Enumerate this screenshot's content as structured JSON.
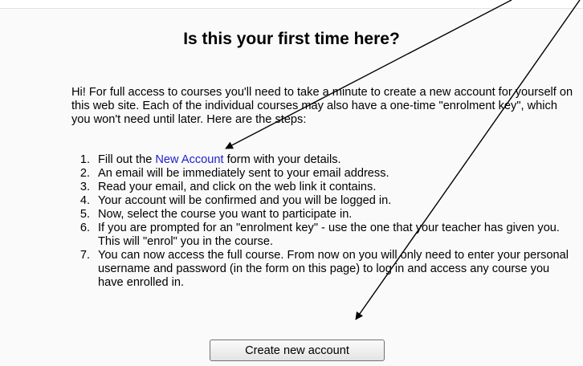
{
  "title": "Is this your first time here?",
  "intro": "Hi! For full access to courses you'll need to take a minute to create a new account for yourself on this web site. Each of the individual courses may also have a one-time \"enrolment key\", which you won't need until later. Here are the steps:",
  "steps": [
    {
      "num": "1.",
      "before": "Fill out the ",
      "link": "New Account",
      "after": " form with your details."
    },
    {
      "num": "2.",
      "text": "An email will be immediately sent to your email address."
    },
    {
      "num": "3.",
      "text": "Read your email, and click on the web link it contains."
    },
    {
      "num": "4.",
      "text": "Your account will be confirmed and you will be logged in."
    },
    {
      "num": "5.",
      "text": "Now, select the course you want to participate in."
    },
    {
      "num": "6.",
      "text": "If you are prompted for an \"enrolment key\" - use the one that your teacher has given you. This will \"enrol\" you in the course."
    },
    {
      "num": "7.",
      "text": "You can now access the full course. From now on you will only need to enter your personal username and password (in the form on this page) to log in and access any course you have enrolled in."
    }
  ],
  "button_label": "Create new account",
  "colors": {
    "link": "#2020d0",
    "arrow": "#000000",
    "panel": "#fafafa"
  }
}
